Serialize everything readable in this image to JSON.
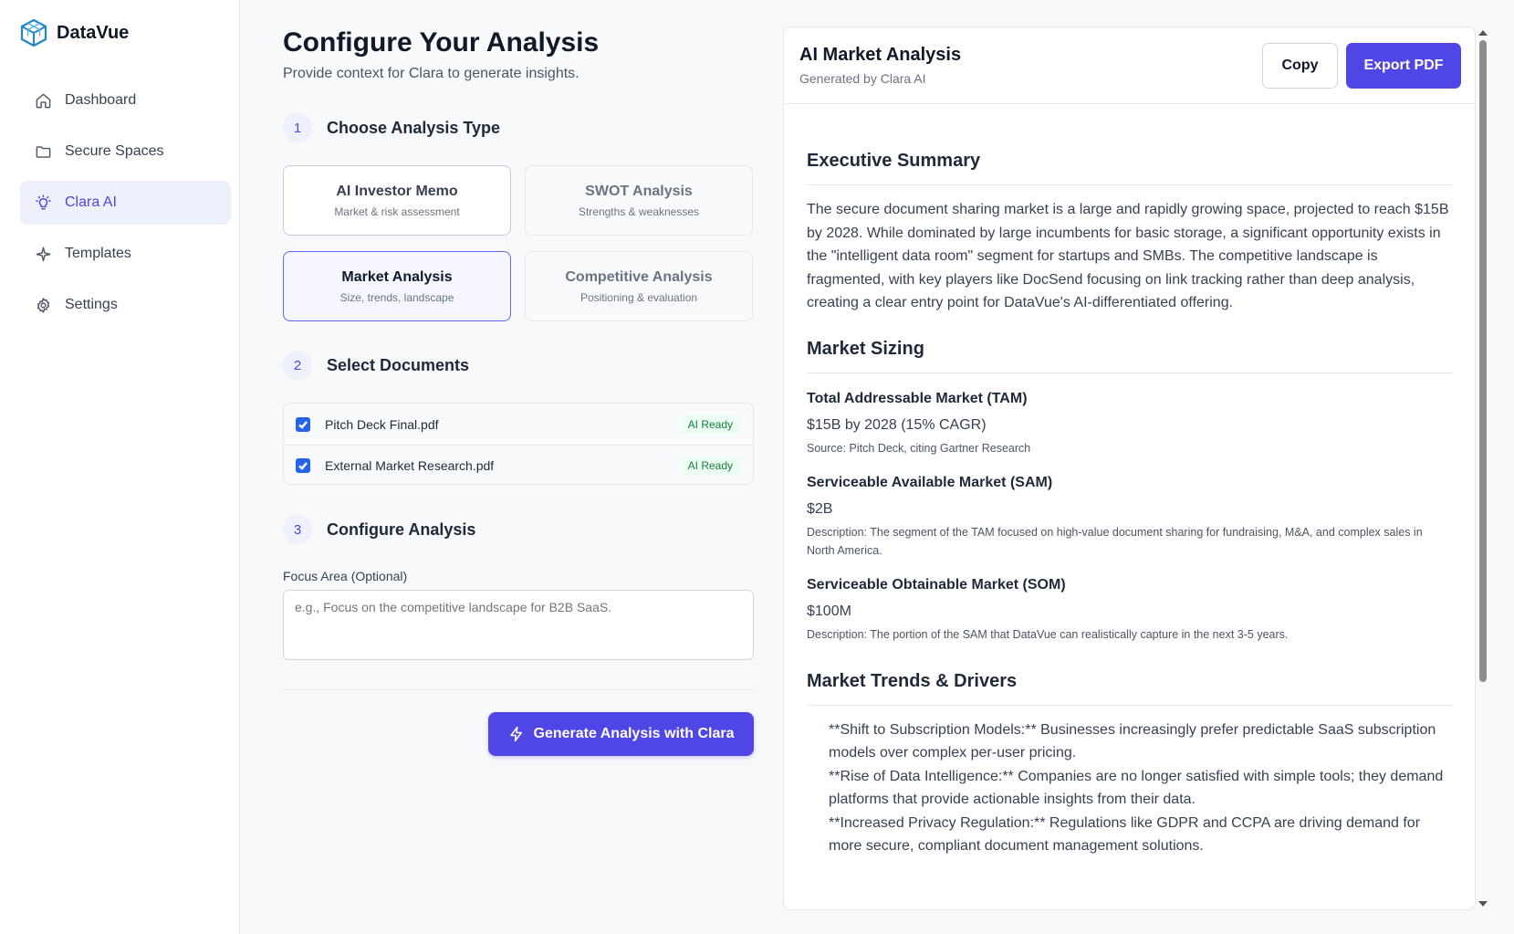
{
  "brand": {
    "name": "DataVue",
    "logo_icon": "cube-logo-icon",
    "accent": "#4f46e5"
  },
  "nav": [
    {
      "label": "Dashboard",
      "icon": "home-icon",
      "active": false
    },
    {
      "label": "Secure Spaces",
      "icon": "folder-icon",
      "active": false
    },
    {
      "label": "Clara AI",
      "icon": "lightbulb-icon",
      "active": true
    },
    {
      "label": "Templates",
      "icon": "sparkle-icon",
      "active": false
    },
    {
      "label": "Settings",
      "icon": "gear-icon",
      "active": false
    }
  ],
  "config": {
    "title": "Configure Your Analysis",
    "subtitle": "Provide context for Clara to generate insights.",
    "steps": [
      {
        "num": "1",
        "title": "Choose Analysis Type"
      },
      {
        "num": "2",
        "title": "Select Documents"
      },
      {
        "num": "3",
        "title": "Configure Analysis"
      }
    ],
    "analysis_types": [
      {
        "title": "AI Investor Memo",
        "subtitle": "Market & risk assessment",
        "state": "available"
      },
      {
        "title": "SWOT Analysis",
        "subtitle": "Strengths & weaknesses",
        "state": "disabled"
      },
      {
        "title": "Market Analysis",
        "subtitle": "Size, trends, landscape",
        "state": "selected"
      },
      {
        "title": "Competitive Analysis",
        "subtitle": "Positioning & evaluation",
        "state": "disabled"
      }
    ],
    "documents": [
      {
        "name": "Pitch Deck Final.pdf",
        "checked": true,
        "badge": "AI Ready"
      },
      {
        "name": "External Market Research.pdf",
        "checked": true,
        "badge": "AI Ready"
      }
    ],
    "focus_label": "Focus Area (Optional)",
    "focus_placeholder": "e.g., Focus on the competitive landscape for B2B SaaS.",
    "focus_value": "",
    "generate_label": "Generate Analysis with Clara"
  },
  "result": {
    "title": "AI Market Analysis",
    "subtitle": "Generated by Clara AI",
    "copy_label": "Copy",
    "export_label": "Export PDF",
    "executive_summary": {
      "heading": "Executive Summary",
      "text": "The secure document sharing market is a large and rapidly growing space, projected to reach $15B by 2028. While dominated by large incumbents for basic storage, a significant opportunity exists in the \"intelligent data room\" segment for startups and SMBs. The competitive landscape is fragmented, with key players like DocSend focusing on link tracking rather than deep analysis, creating a clear entry point for DataVue's AI-differentiated offering."
    },
    "market_sizing": {
      "heading": "Market Sizing",
      "items": [
        {
          "title": "Total Addressable Market (TAM)",
          "value": "$15B by 2028 (15% CAGR)",
          "note": "Source: Pitch Deck, citing Gartner Research"
        },
        {
          "title": "Serviceable Available Market (SAM)",
          "value": "$2B",
          "note": "Description: The segment of the TAM focused on high-value document sharing for fundraising, M&A, and complex sales in North America."
        },
        {
          "title": "Serviceable Obtainable Market (SOM)",
          "value": "$100M",
          "note": "Description: The portion of the SAM that DataVue can realistically capture in the next 3-5 years."
        }
      ]
    },
    "trends": {
      "heading": "Market Trends & Drivers",
      "items": [
        "**Shift to Subscription Models:** Businesses increasingly prefer predictable SaaS subscription models over complex per-user pricing.",
        "**Rise of Data Intelligence:** Companies are no longer satisfied with simple tools; they demand platforms that provide actionable insights from their data.",
        "**Increased Privacy Regulation:** Regulations like GDPR and CCPA are driving demand for more secure, compliant document management solutions."
      ]
    }
  }
}
